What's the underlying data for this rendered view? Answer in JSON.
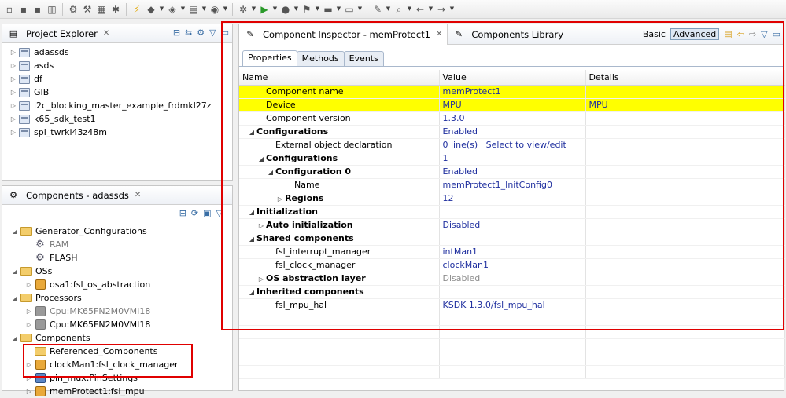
{
  "toolbar": {
    "icons": [
      "new-icon",
      "save-icon",
      "save-all-icon",
      "print-icon",
      "gear-icon",
      "hammer-icon",
      "binary-icon",
      "debug-icon",
      "flash-icon",
      "new-class-icon",
      "new-package-icon",
      "new-file-icon",
      "new-project-icon",
      "build-icon",
      "run-icon",
      "debug-run-icon",
      "external-tools-icon",
      "open-folder-icon",
      "open-file-icon",
      "pin-icon",
      "search-icon",
      "back-icon",
      "forward-icon"
    ]
  },
  "project_explorer": {
    "title": "Project Explorer",
    "items": [
      "adassds",
      "asds",
      "df",
      "GIB",
      "i2c_blocking_master_example_frdmkl27z",
      "k65_sdk_test1",
      "spi_twrkl43z48m"
    ]
  },
  "components": {
    "title": "Components - adassds",
    "tree": [
      {
        "label": "Generator_Configurations",
        "level": 0,
        "expanded": true,
        "icon": "folder-icon"
      },
      {
        "label": "RAM",
        "level": 1,
        "icon": "gear-icon",
        "muted": true
      },
      {
        "label": "FLASH",
        "level": 1,
        "icon": "gear-icon"
      },
      {
        "label": "OSs",
        "level": 0,
        "expanded": true,
        "icon": "folder-icon"
      },
      {
        "label": "osa1:fsl_os_abstraction",
        "level": 1,
        "collapsed": true,
        "icon": "component-icon"
      },
      {
        "label": "Processors",
        "level": 0,
        "expanded": true,
        "icon": "folder-icon"
      },
      {
        "label": "Cpu:MK65FN2M0VMI18",
        "level": 1,
        "collapsed": true,
        "icon": "chip-icon",
        "muted": true
      },
      {
        "label": "Cpu:MK65FN2M0VMI18",
        "level": 1,
        "collapsed": true,
        "icon": "chip-icon"
      },
      {
        "label": "Components",
        "level": 0,
        "expanded": true,
        "icon": "folder-icon"
      },
      {
        "label": "Referenced_Components",
        "level": 1,
        "icon": "folder-icon"
      },
      {
        "label": "clockMan1:fsl_clock_manager",
        "level": 1,
        "collapsed": true,
        "icon": "component-icon"
      },
      {
        "label": "pin_mux:PinSettings",
        "level": 1,
        "collapsed": true,
        "icon": "pin-icon"
      },
      {
        "label": "memProtect1:fsl_mpu",
        "level": 1,
        "collapsed": true,
        "icon": "component-icon"
      }
    ]
  },
  "inspector": {
    "tab_title": "Component Inspector - memProtect1",
    "library_tab": "Components Library",
    "mode_basic": "Basic",
    "mode_advanced": "Advanced",
    "subtabs": [
      "Properties",
      "Methods",
      "Events"
    ],
    "columns": [
      "Name",
      "Value",
      "Details"
    ],
    "rows": [
      {
        "name": "Component name",
        "value": "memProtect1",
        "details": "",
        "indent": 1,
        "highlight": true
      },
      {
        "name": "Device",
        "value": "MPU",
        "details": "MPU",
        "indent": 1,
        "highlight": true
      },
      {
        "name": "Component version",
        "value": "1.3.0",
        "details": "",
        "indent": 1
      },
      {
        "name": "Configurations",
        "value": "Enabled",
        "details": "",
        "indent": 0,
        "toggle": "open",
        "bold": true
      },
      {
        "name": "External object declaration",
        "value": "0 line(s)",
        "value2": "Select to view/edit",
        "details": "",
        "indent": 2
      },
      {
        "name": "Configurations",
        "value": "1",
        "details": "",
        "indent": 1,
        "toggle": "open",
        "bold": true
      },
      {
        "name": "Configuration 0",
        "value": "Enabled",
        "details": "",
        "indent": 2,
        "toggle": "open",
        "bold": true
      },
      {
        "name": "Name",
        "value": "memProtect1_InitConfig0",
        "details": "",
        "indent": 4
      },
      {
        "name": "Regions",
        "value": "12",
        "details": "",
        "indent": 3,
        "toggle": "closed",
        "bold": true
      },
      {
        "name": "Initialization",
        "value": "",
        "details": "",
        "indent": 0,
        "toggle": "open",
        "bold": true
      },
      {
        "name": "Auto initialization",
        "value": "Disabled",
        "details": "",
        "indent": 1,
        "toggle": "closed",
        "bold": true
      },
      {
        "name": "Shared components",
        "value": "",
        "details": "",
        "indent": 0,
        "toggle": "open",
        "bold": true
      },
      {
        "name": "fsl_interrupt_manager",
        "value": "intMan1",
        "details": "",
        "indent": 2
      },
      {
        "name": "fsl_clock_manager",
        "value": "clockMan1",
        "details": "",
        "indent": 2
      },
      {
        "name": "OS abstraction layer",
        "value": "Disabled",
        "details": "",
        "indent": 1,
        "toggle": "closed",
        "bold": true,
        "muted_value": true
      },
      {
        "name": "Inherited components",
        "value": "",
        "details": "",
        "indent": 0,
        "toggle": "open",
        "bold": true
      },
      {
        "name": "fsl_mpu_hal",
        "value": "KSDK 1.3.0/fsl_mpu_hal",
        "details": "",
        "indent": 2
      }
    ]
  },
  "colors": {
    "highlight": "#ffff00",
    "annotation": "#e00000",
    "value_text": "#1f2f9f"
  }
}
